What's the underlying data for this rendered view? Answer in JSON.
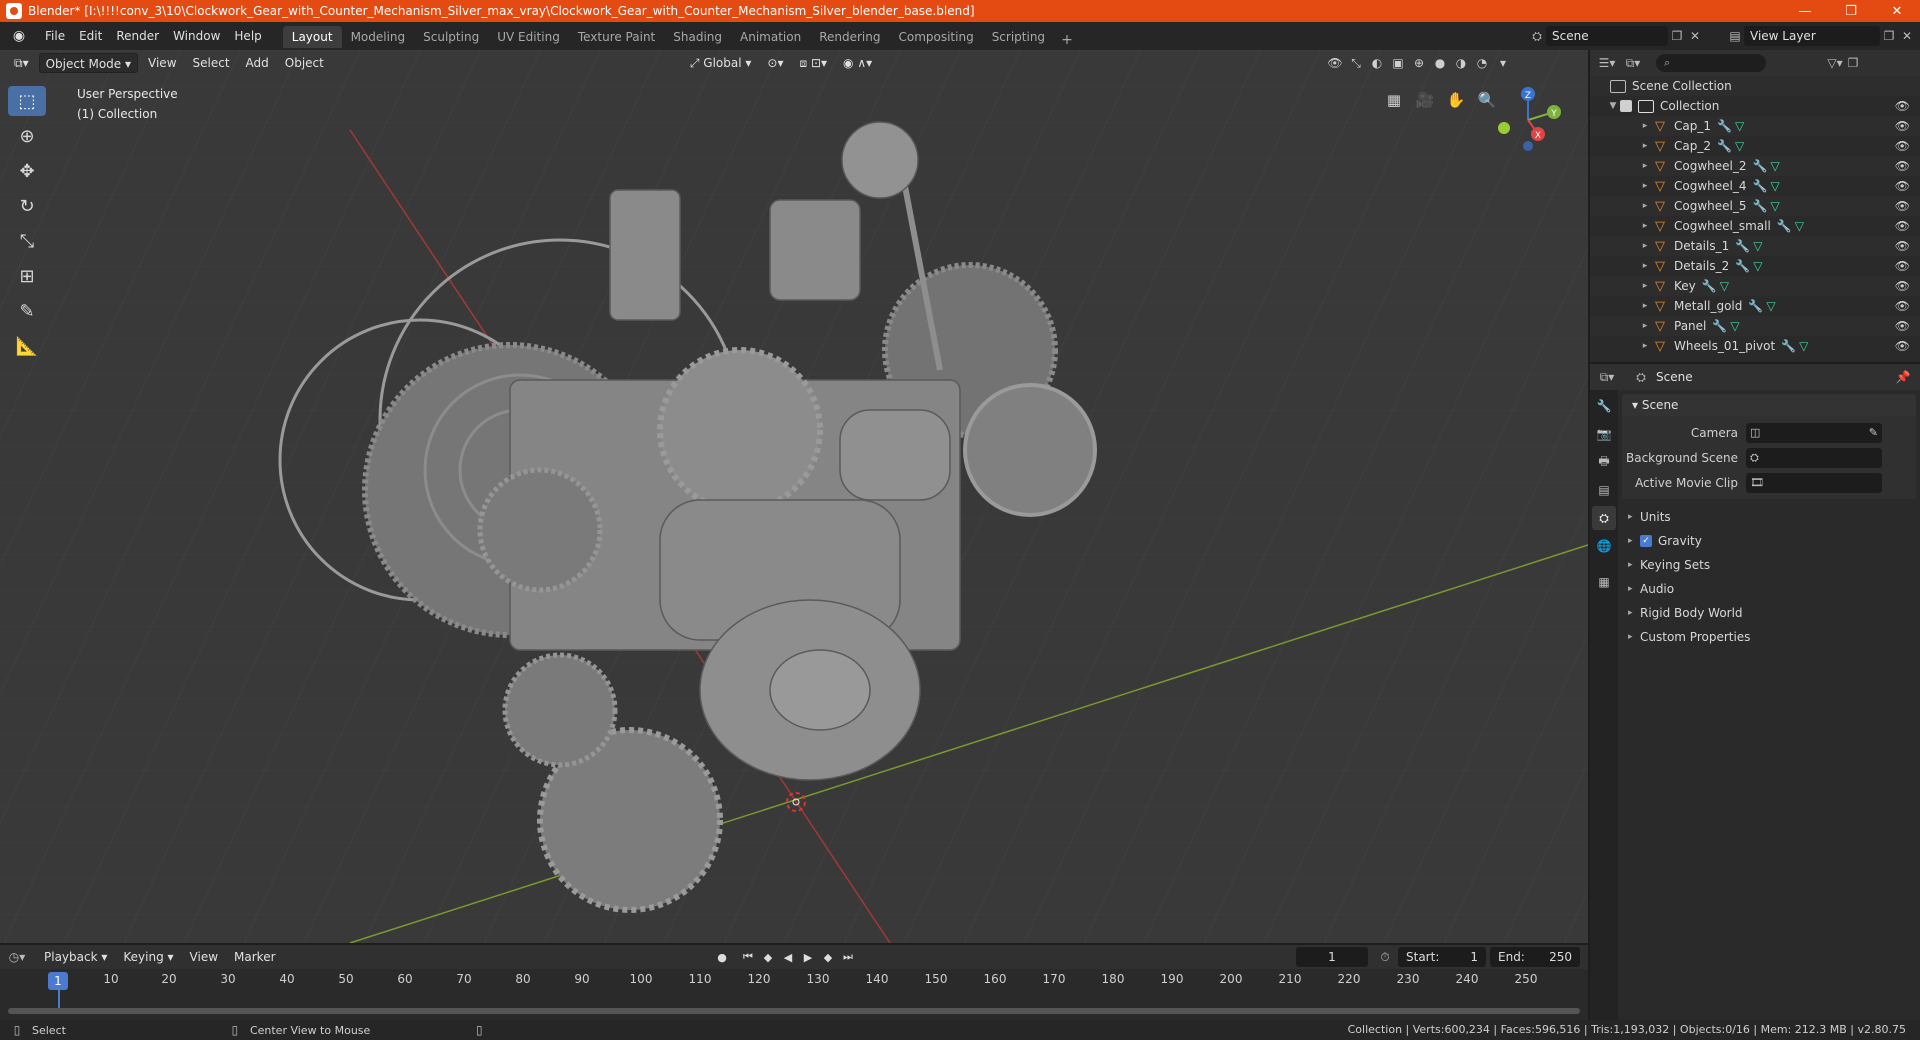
{
  "window": {
    "title": "Blender* [I:\\!!!!conv_3\\10\\Clockwork_Gear_with_Counter_Mechanism_Silver_max_vray\\Clockwork_Gear_with_Counter_Mechanism_Silver_blender_base.blend]",
    "controls": [
      "—",
      "❐",
      "✕"
    ]
  },
  "menu": [
    "File",
    "Edit",
    "Render",
    "Window",
    "Help"
  ],
  "workspaces": [
    "Layout",
    "Modeling",
    "Sculpting",
    "UV Editing",
    "Texture Paint",
    "Shading",
    "Animation",
    "Rendering",
    "Compositing",
    "Scripting"
  ],
  "active_workspace": "Layout",
  "scene_name": "Scene",
  "view_layer": "View Layer",
  "viewport": {
    "mode": "Object Mode",
    "menus": [
      "View",
      "Select",
      "Add",
      "Object"
    ],
    "orientation": "Global",
    "perspective": "User Perspective",
    "collection_info": "(1) Collection",
    "gizmo_axes": [
      "Z",
      "Y",
      "X"
    ]
  },
  "outliner": {
    "root": "Scene Collection",
    "collection": "Collection",
    "objects": [
      "Cap_1",
      "Cap_2",
      "Cogwheel_2",
      "Cogwheel_4",
      "Cogwheel_5",
      "Cogwheel_small",
      "Details_1",
      "Details_2",
      "Key",
      "Metall_gold",
      "Panel",
      "Wheels_01_pivot"
    ]
  },
  "properties": {
    "header": "Scene",
    "panel": "Scene",
    "fields": [
      {
        "label": "Camera"
      },
      {
        "label": "Background Scene"
      },
      {
        "label": "Active Movie Clip"
      }
    ],
    "subpanels": [
      "Units",
      "Gravity",
      "Keying Sets",
      "Audio",
      "Rigid Body World",
      "Custom Properties"
    ]
  },
  "timeline": {
    "menus": [
      "Playback",
      "Keying",
      "View",
      "Marker"
    ],
    "current_frame": "1",
    "start_label": "Start:",
    "start": "1",
    "end_label": "End:",
    "end": "250",
    "ticks": [
      "10",
      "20",
      "30",
      "40",
      "50",
      "60",
      "70",
      "80",
      "90",
      "100",
      "110",
      "120",
      "130",
      "140",
      "150",
      "160",
      "170",
      "180",
      "190",
      "200",
      "210",
      "220",
      "230",
      "240",
      "250"
    ]
  },
  "status": {
    "left_action": "Select",
    "middle_action": "Center View to Mouse",
    "stats": "Collection | Verts:600,234 | Faces:596,516 | Tris:1,193,032 | Objects:0/16 | Mem: 212.3 MB | v2.80.75"
  }
}
